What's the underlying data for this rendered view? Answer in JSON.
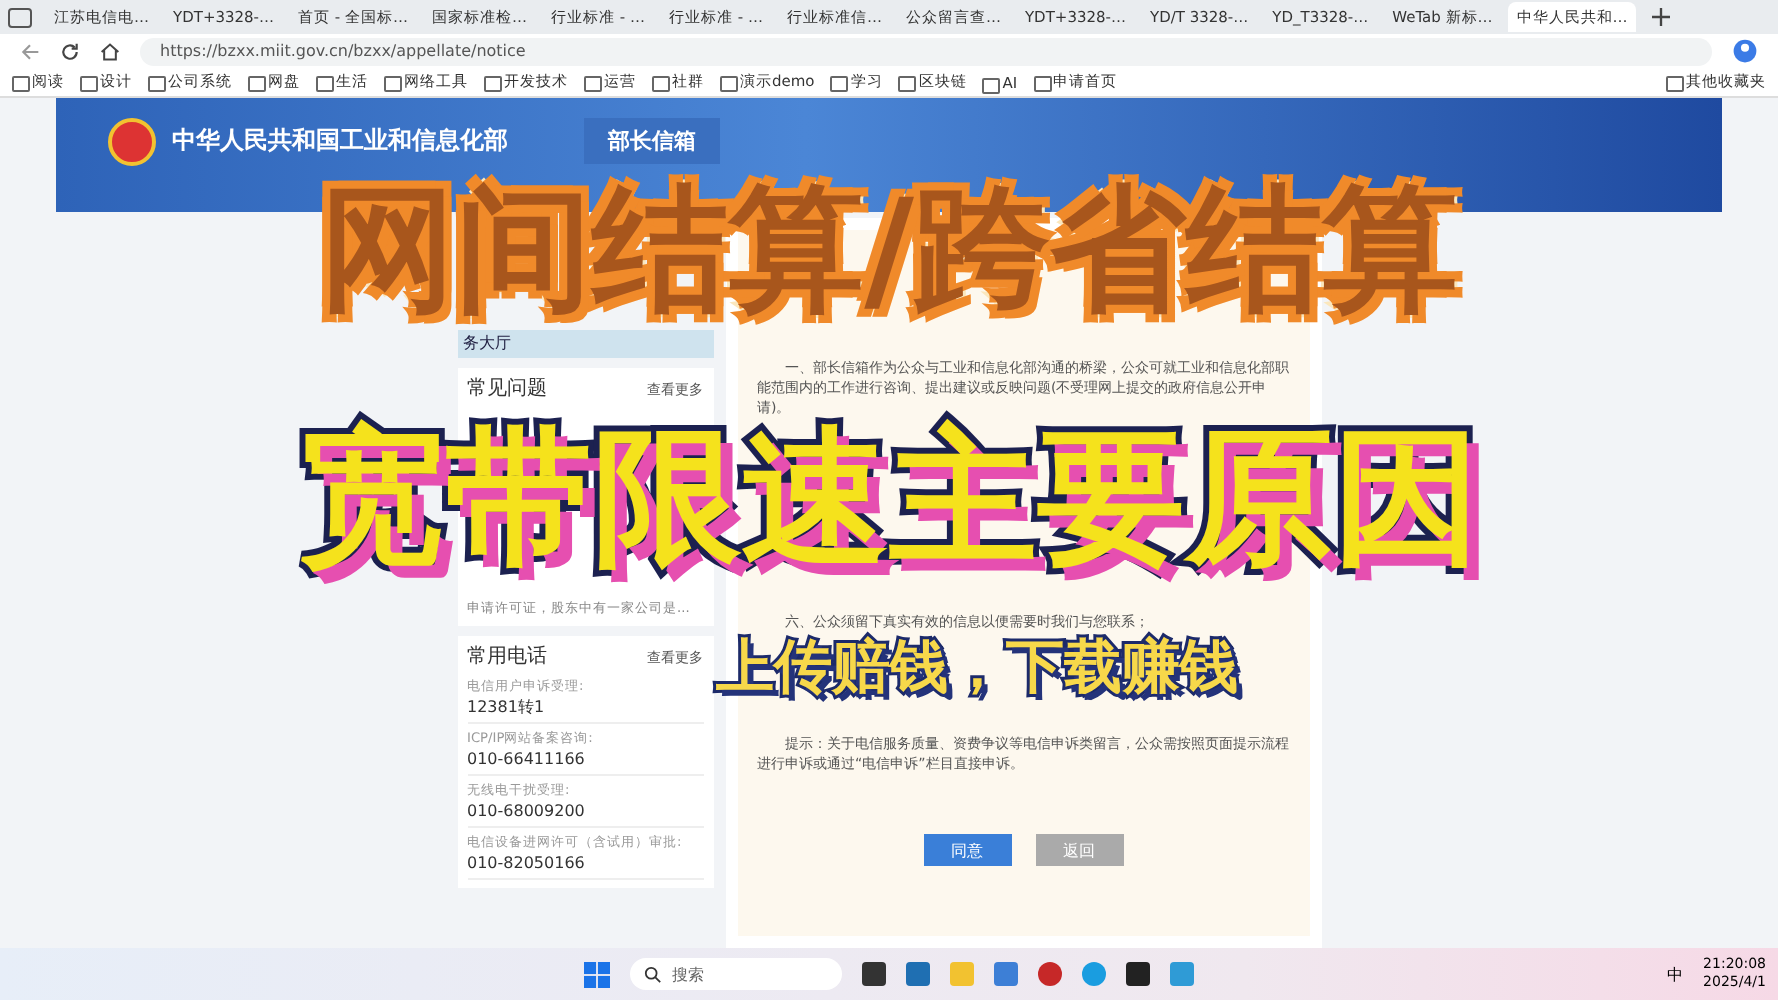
{
  "browser": {
    "tabs": [
      {
        "title": "江苏电信电…",
        "selected": false
      },
      {
        "title": "YDT+3328-…",
        "selected": false
      },
      {
        "title": "首页 - 全国标…",
        "selected": false
      },
      {
        "title": "国家标准检…",
        "selected": false
      },
      {
        "title": "行业标准 - …",
        "selected": false
      },
      {
        "title": "行业标准 - …",
        "selected": false
      },
      {
        "title": "行业标准信…",
        "selected": false
      },
      {
        "title": "公众留言查…",
        "selected": false
      },
      {
        "title": "YDT+3328-…",
        "selected": false
      },
      {
        "title": "YD/T 3328-…",
        "selected": false
      },
      {
        "title": "YD_T3328-…",
        "selected": false
      },
      {
        "title": "WeTab 新标…",
        "selected": false
      },
      {
        "title": "中华人民共和…",
        "selected": true
      }
    ],
    "url": "https://bzxx.miit.gov.cn/bzxx/appellate/notice",
    "bookmarks": [
      "阅读",
      "设计",
      "公司系统",
      "网盘",
      "生活",
      "网络工具",
      "开发技术",
      "运营",
      "社群",
      "演示demo",
      "学习",
      "区块链",
      "AI",
      "申请首页"
    ],
    "other_bookmarks": "其他收藏夹"
  },
  "page": {
    "header": {
      "ministry": "中华人民共和国工业和信息化部",
      "mailbox_tab": "部长信箱"
    },
    "sidebar": {
      "service_hall": "务大厅",
      "faq": {
        "title": "常见问题",
        "more": "查看更多",
        "items": [
          "申请许可证，股东中有一家公司是..."
        ]
      },
      "phones": {
        "title": "常用电话",
        "more": "查看更多",
        "items": [
          {
            "label": "电信用户申诉受理:",
            "number": "12381转1"
          },
          {
            "label": "ICP/IP网站备案咨询:",
            "number": "010-66411166"
          },
          {
            "label": "无线电干扰受理:",
            "number": "010-68009200"
          },
          {
            "label": "电信设备进网许可（含试用）审批:",
            "number": "010-82050166"
          }
        ]
      }
    },
    "notice": {
      "paragraphs": [
        "一、部长信箱作为公众与工业和信息化部沟通的桥梁，公众可就工业和信息化部职能范围内的工作进行咨询、提出建议或反映问题(不受理网上提交的政府信息公开申请)。",
        "六、公众须留下真实有效的信息以便需要时我们与您联系；",
        "提示：关于电信服务质量、资费争议等电信申诉类留言，公众需按照页面提示流程进行申诉或通过“电信申诉”栏目直接申诉。"
      ],
      "buttons": [
        {
          "label": "同意",
          "kind": "primary"
        },
        {
          "label": "返回",
          "kind": "secondary"
        }
      ]
    }
  },
  "captions": [
    {
      "text": "网间结算/跨省结算",
      "kind": "headline"
    },
    {
      "text": "宽带限速主要原因",
      "kind": "subheadline"
    },
    {
      "text": "上传赔钱，下载赚钱",
      "kind": "tagline"
    }
  ],
  "taskbar": {
    "search": {
      "placeholder": "搜索"
    },
    "language": "中",
    "time": "21:20:08",
    "date": "2025/4/1"
  }
}
